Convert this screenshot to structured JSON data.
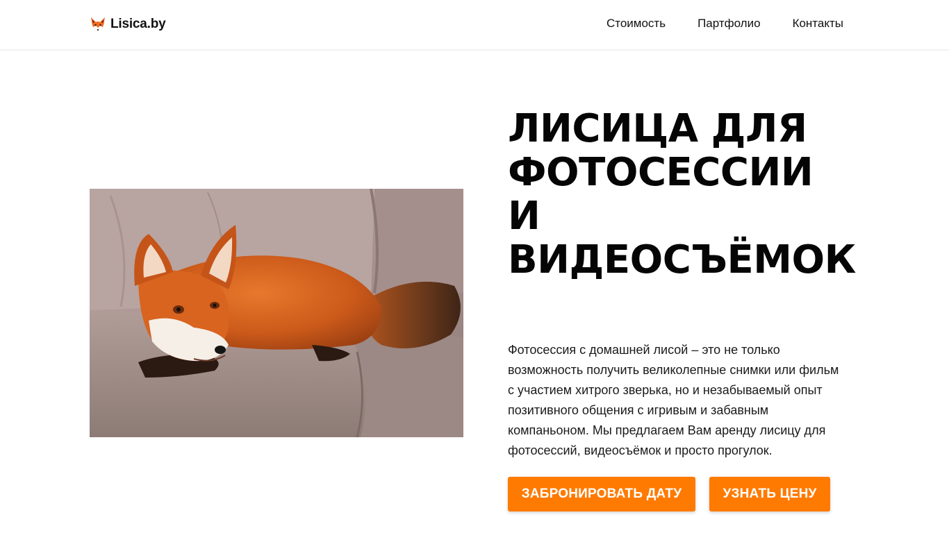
{
  "header": {
    "logo_icon": "fox-icon",
    "logo_text": "Lisica.by",
    "nav": [
      {
        "label": "Стоимость"
      },
      {
        "label": "Партфолио"
      },
      {
        "label": "Контакты"
      }
    ]
  },
  "hero": {
    "image": "fox-on-sofa-photo",
    "title_lines": [
      "Лисица для",
      "фотосессии",
      "и",
      "видеосъёмок"
    ],
    "description": "Фотосессия с домашней лисой – это не только возможность получить великолепные снимки или фильм с участием хитрого зверька, но и незабываемый опыт позитивного общения с игривым и забавным компаньоном. Мы предлагаем Вам аренду лисицу для фотосессий, видеосъёмок и просто прогулок.",
    "buttons": {
      "book": "Забронировать дату",
      "price": "Узнать цену"
    }
  },
  "colors": {
    "accent": "#ff7a00",
    "text": "#111111",
    "background": "#ffffff"
  }
}
